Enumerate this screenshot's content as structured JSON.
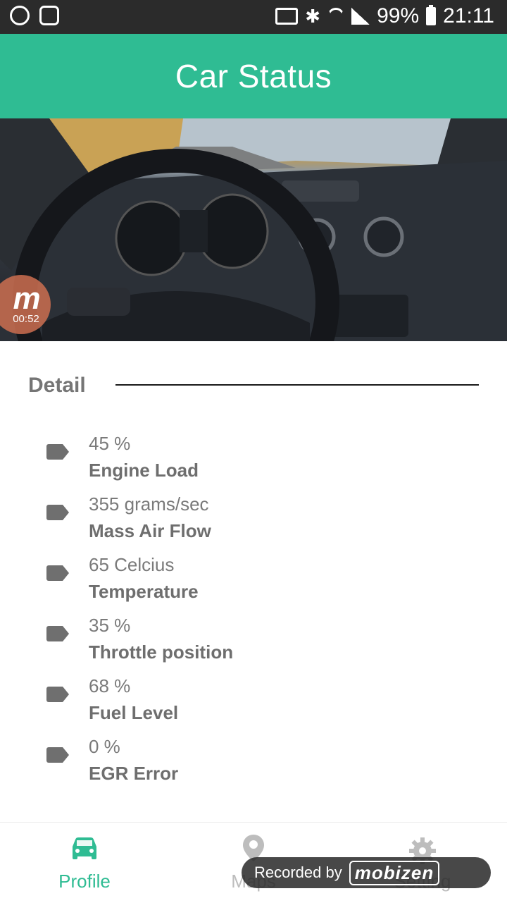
{
  "status_bar": {
    "battery": "99%",
    "time": "21:11",
    "icons": [
      "mobizen-icon",
      "screenshot-icon",
      "cast-icon",
      "bluetooth-icon",
      "wifi-icon",
      "signal-icon",
      "battery-icon"
    ]
  },
  "app_bar": {
    "title": "Car Status"
  },
  "recording_badge": {
    "logo": "m",
    "elapsed": "00:52"
  },
  "detail": {
    "title": "Detail",
    "items": [
      {
        "value": "45 %",
        "label": "Engine Load",
        "icon": "tag-icon"
      },
      {
        "value": "355 grams/sec",
        "label": "Mass Air Flow",
        "icon": "tag-icon"
      },
      {
        "value": "65 Celcius",
        "label": "Temperature",
        "icon": "tag-icon"
      },
      {
        "value": "35 %",
        "label": "Throttle position",
        "icon": "tag-icon"
      },
      {
        "value": "68 %",
        "label": "Fuel Level",
        "icon": "tag-icon"
      },
      {
        "value": "0 %",
        "label": "EGR Error",
        "icon": "tag-icon"
      }
    ]
  },
  "bottom_nav": {
    "items": [
      {
        "label": "Profile",
        "icon": "car-icon",
        "active": true
      },
      {
        "label": "Maps",
        "icon": "map-pin-icon",
        "active": false
      },
      {
        "label": "Setting",
        "icon": "gear-icon",
        "active": false
      }
    ]
  },
  "recorded_banner": {
    "text": "Recorded by",
    "logo": "mobizen"
  },
  "colors": {
    "primary": "#2fbc93",
    "status_bar": "#2b2b2b",
    "text_muted": "#757575",
    "nav_inactive": "#bdbdbd"
  }
}
